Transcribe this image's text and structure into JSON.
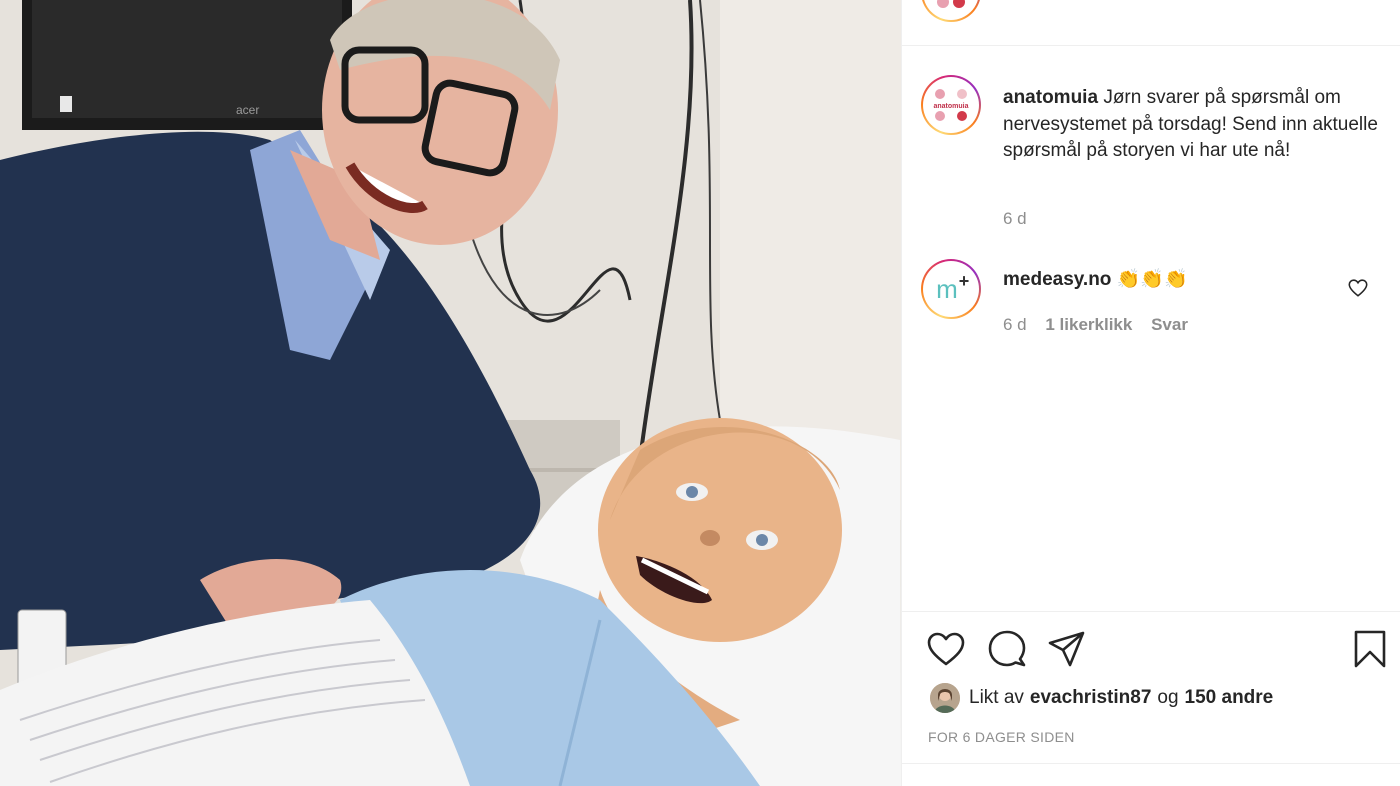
{
  "post": {
    "author": "anatomuia",
    "caption": "Jørn svarer på spørsmål om nervesystemet på torsdag! Send inn aktuelle spørsmål på storyen vi har ute nå!",
    "caption_time": "6 d",
    "avatar_logo_text": "anatomuia"
  },
  "comments": [
    {
      "user": "medeasy.no",
      "text": "👏👏👏",
      "time": "6 d",
      "likes": "1 likerklikk",
      "reply": "Svar",
      "avatar_text": "m+"
    }
  ],
  "actions": {
    "like_icon": "heart-icon",
    "comment_icon": "comment-icon",
    "share_icon": "share-icon",
    "save_icon": "bookmark-icon"
  },
  "likes": {
    "prefix": "Likt av",
    "user": "evachristin87",
    "conj": "og",
    "others": "150 andre"
  },
  "posted": "FOR 6 DAGER SIDEN",
  "colors": {
    "text": "#262626",
    "muted": "#8e8e8e",
    "divider": "#efefef",
    "medeasy_accent": "#5bc0be"
  }
}
